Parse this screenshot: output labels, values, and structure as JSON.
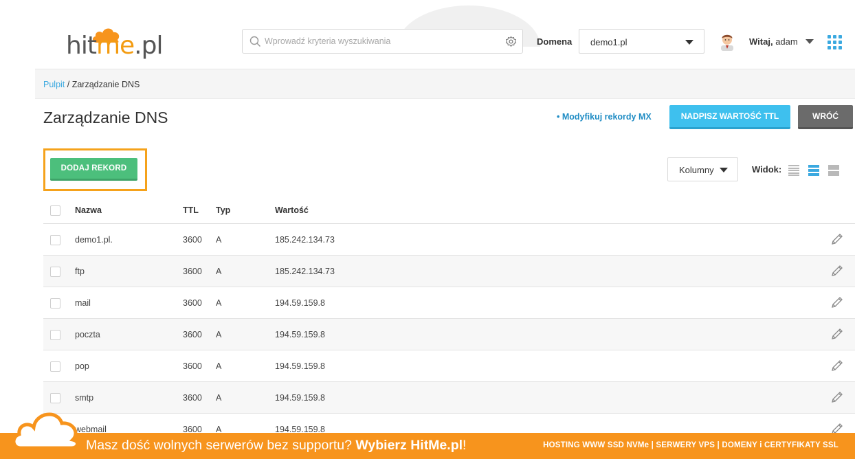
{
  "header": {
    "logo": {
      "hit": "hit",
      "me": "me",
      "pl": ".pl"
    },
    "search": {
      "placeholder": "Wprowadź kryteria wyszukiwania"
    },
    "domena_label": "Domena",
    "domena_value": "demo1.pl",
    "welcome_prefix": "Witaj,",
    "welcome_user": "adam"
  },
  "breadcrumb": {
    "root": "Pulpit",
    "separator": " / ",
    "current": "Zarządzanie DNS"
  },
  "page": {
    "title": "Zarządzanie DNS",
    "mx_link": "• Modyfikuj rekordy MX",
    "ttl_button": "NADPISZ WARTOŚĆ TTL",
    "back_button": "WRÓĆ",
    "add_button": "DODAJ REKORD",
    "columns_button": "Kolumny",
    "view_label": "Widok:"
  },
  "table": {
    "headers": {
      "name": "Nazwa",
      "ttl": "TTL",
      "type": "Typ",
      "value": "Wartość"
    },
    "rows": [
      {
        "name": "demo1.pl.",
        "ttl": "3600",
        "type": "A",
        "value": "185.242.134.73"
      },
      {
        "name": "ftp",
        "ttl": "3600",
        "type": "A",
        "value": "185.242.134.73"
      },
      {
        "name": "mail",
        "ttl": "3600",
        "type": "A",
        "value": "194.59.159.8"
      },
      {
        "name": "poczta",
        "ttl": "3600",
        "type": "A",
        "value": "194.59.159.8"
      },
      {
        "name": "pop",
        "ttl": "3600",
        "type": "A",
        "value": "194.59.159.8"
      },
      {
        "name": "smtp",
        "ttl": "3600",
        "type": "A",
        "value": "194.59.159.8"
      },
      {
        "name": "webmail",
        "ttl": "3600",
        "type": "A",
        "value": "194.59.159.8"
      }
    ]
  },
  "banner": {
    "text": "Masz dość wolnych serwerów bez supportu?",
    "cta": "Wybierz HitMe.pl",
    "cta_suffix": "!",
    "right": "HOSTING WWW SSD NVMe | SERWERY VPS | DOMENY i CERTYFIKATY SSL"
  },
  "colors": {
    "accent_blue": "#3ba9e0",
    "green": "#4cbf7c",
    "orange": "#f7941d",
    "highlight": "#f5a21b",
    "gray_button": "#6b6b6b"
  },
  "icons": [
    "search-icon",
    "settings-icon",
    "chevron-down-icon",
    "avatar",
    "apps-grid-icon",
    "list-view-icon",
    "rows-view-icon",
    "cards-view-icon",
    "pencil-icon",
    "cloud-icon"
  ]
}
